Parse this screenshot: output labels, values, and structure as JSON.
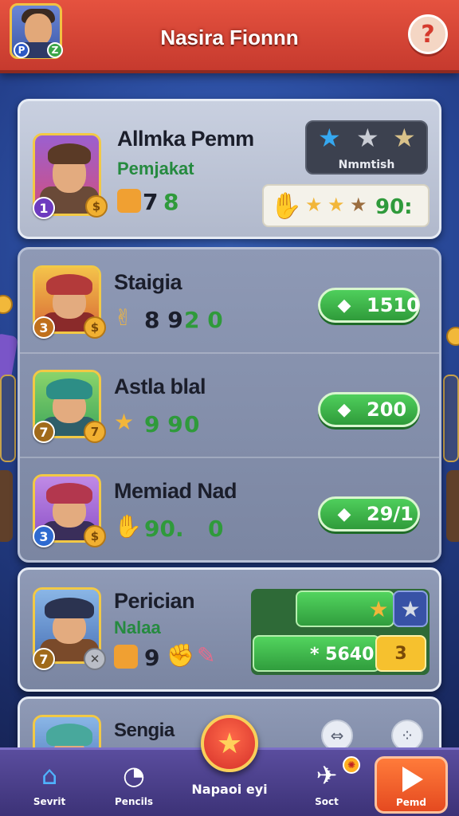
{
  "header": {
    "title": "Nasira Fionnn",
    "help_icon": "question-icon",
    "avatar_badges": [
      "P",
      "Z"
    ]
  },
  "featured": {
    "name": "Allmka Pemm",
    "subtitle": "Pemjakat",
    "level": "1",
    "coin_symbol": "$",
    "stat_a": "7",
    "stat_b": "8",
    "stat_icon": "coin-icon",
    "rank_label": "Nmmtish",
    "rank_stars": [
      "blue",
      "silver",
      "gold"
    ],
    "score_value": "90:"
  },
  "players": [
    {
      "name": "Staigia",
      "level": "3",
      "stat_a": "8 9",
      "stat_b": "2 0",
      "stat_icon": "victory-hand-icon",
      "button": "1510",
      "avatar_color": "#d86a36"
    },
    {
      "name": "Astla blal",
      "level": "7",
      "stat_a": "9 9",
      "stat_b": "0",
      "stat_icon": "star-icon",
      "button": "200",
      "avatar_color": "#3ea65b"
    },
    {
      "name": "Memiad Nad",
      "level": "3",
      "stat_a": "90.",
      "stat_b": "0",
      "stat_icon": "hand-icon",
      "button": "29/1",
      "avatar_color": "#8d52c8"
    }
  ],
  "pericial": {
    "name": "Perician",
    "subtitle": "Nalaa",
    "level": "7",
    "stat_a": "9",
    "bar_value": "* 5640",
    "bar_badge": "3"
  },
  "partial": {
    "name": "Sengia"
  },
  "nav": {
    "items": [
      {
        "label": "Sevrit",
        "icon": "home-icon"
      },
      {
        "label": "Pencils",
        "icon": "timer-icon"
      },
      {
        "label": "Soct",
        "icon": "plane-icon"
      }
    ],
    "center_label": "Napaoi eyi",
    "play_label": "Pemd"
  },
  "colors": {
    "header": "#d8473a",
    "accent_green": "#2f9a3b",
    "background": "#24408c"
  }
}
